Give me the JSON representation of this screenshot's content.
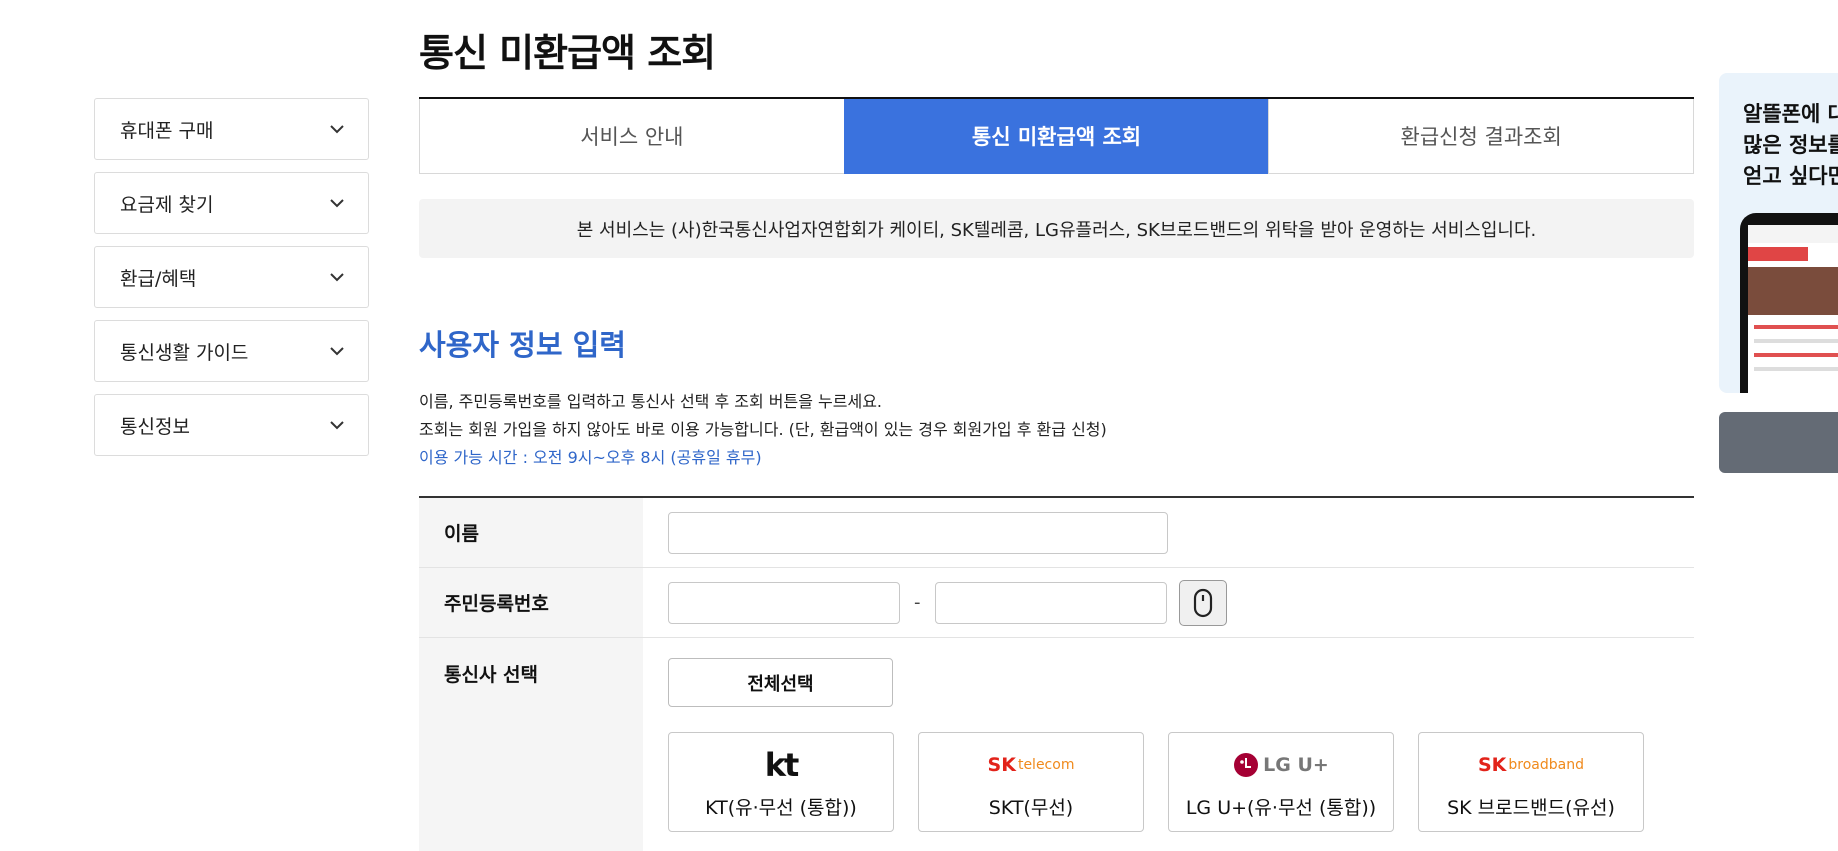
{
  "sidebar": {
    "items": [
      {
        "label": "휴대폰 구매"
      },
      {
        "label": "요금제 찾기"
      },
      {
        "label": "환급/혜택"
      },
      {
        "label": "통신생활 가이드"
      },
      {
        "label": "통신정보"
      }
    ]
  },
  "page": {
    "title": "통신 미환급액 조회"
  },
  "tabs": [
    {
      "label": "서비스 안내",
      "active": false
    },
    {
      "label": "통신 미환급액 조회",
      "active": true
    },
    {
      "label": "환급신청 결과조회",
      "active": false
    }
  ],
  "notice": "본 서비스는 (사)한국통신사업자연합회가 케이티, SK텔레콤, LG유플러스, SK브로드밴드의 위탁을 받아 운영하는 서비스입니다.",
  "section": {
    "title": "사용자 정보 입력",
    "desc_line1": "이름, 주민등록번호를 입력하고 통신사 선택 후 조회 버튼을 누르세요.",
    "desc_line2": "조회는 회원 가입을 하지 않아도 바로 이용 가능합니다. (단, 환급액이 있는 경우 회원가입 후 환급 신청)",
    "hours": "이용 가능 시간 : 오전 9시~오후 8시 (공휴일 휴무)"
  },
  "form": {
    "name_label": "이름",
    "name_value": "",
    "rrn_label": "주민등록번호",
    "rrn_front": "",
    "rrn_back": "",
    "rrn_dash": "-",
    "carrier_label": "통신사 선택",
    "select_all": "전체선택",
    "carriers": [
      {
        "name": "KT(유·무선 (통합))",
        "logo": "kt"
      },
      {
        "name": "SKT(무선)",
        "logo_main": "SK",
        "logo_sub": "telecom"
      },
      {
        "name": "LG U+(유·무선 (통합))",
        "logo": "LG U+"
      },
      {
        "name": "SK 브로드밴드(유선)",
        "logo_main": "SK",
        "logo_sub": "broadband"
      }
    ]
  },
  "banner": {
    "line1": "알뜰폰에 대",
    "line2": "많은 정보를",
    "line3": "얻고 싶다면"
  },
  "colors": {
    "accent": "#3a72de",
    "section_title": "#2f66c9",
    "notice_bg": "#f3f3f3"
  }
}
